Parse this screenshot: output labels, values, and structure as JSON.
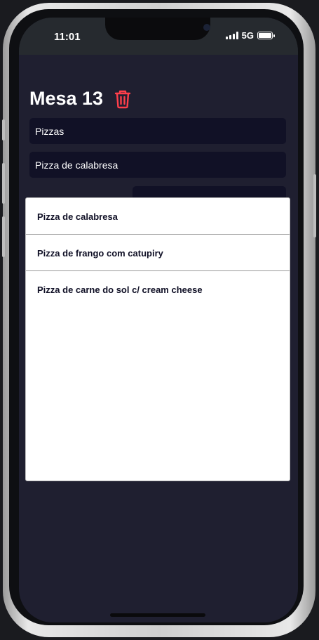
{
  "status_bar": {
    "time": "11:01",
    "network": "5G",
    "battery_icon": "battery-full-icon",
    "signal_icon": "signal-bars-icon"
  },
  "header": {
    "title": "Mesa 13",
    "delete_icon": "trash-icon",
    "delete_color": "#ff3f4b"
  },
  "form": {
    "category_value": "Pizzas",
    "product_value": "Pizza de calabresa"
  },
  "product_picker": {
    "options": [
      {
        "label": "Pizza de calabresa"
      },
      {
        "label": "Pizza de frango com catupiry"
      },
      {
        "label": "Pizza de carne do sol c/ cream cheese"
      }
    ]
  },
  "colors": {
    "background": "#1f1f30",
    "input_bg": "#111126",
    "accent_red": "#ff3f4b",
    "status_bar": "#262a2f"
  }
}
